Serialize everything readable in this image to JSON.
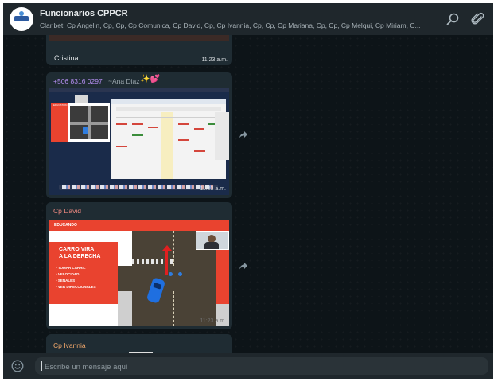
{
  "header": {
    "group_name": "Funcionarios CPPCR",
    "participants": "Claribet, Cp Angelin, Cp, Cp, Cp Comunica, Cp David, Cp, Cp Ivannia, Cp, Cp, Cp Mariana, Cp, Cp, Cp Melqui, Cp Miriam, C..."
  },
  "messages": [
    {
      "sender": "Cristina",
      "time": "11:23 a.m."
    },
    {
      "sender_phone": "+506 8316 0297",
      "sender_name": "~Ana Diaz",
      "emoji": "✨💕",
      "time": "11:23 a.m.",
      "screen": {
        "slide_tab": "EDUCATION",
        "weekday_headers": [
          "LU",
          "MA",
          "MI",
          "JU",
          "VI",
          "SA",
          "DO"
        ]
      }
    },
    {
      "sender": "Cp David",
      "time": "11:23 a.m.",
      "slide": {
        "tag": "EDUCANDO",
        "title_lines": [
          "CARRO VIRA",
          "A LA DERECHA"
        ],
        "bullets": [
          "• TOMAR CARRIL",
          "• VELOCIDAD",
          "• SEÑALES",
          "• VER DIRECCIONALES"
        ]
      }
    },
    {
      "sender": "Cp Ivannia"
    }
  ],
  "composer": {
    "placeholder": "Escribe un mensaje aquí"
  },
  "colors": {
    "cristina_name": "#dfe3e5",
    "ana_name": "#b48ef0",
    "david_name": "#f28b82",
    "ivannia_name": "#f2a86b",
    "slide_red": "#e9432f"
  },
  "icons": [
    "search-icon",
    "attach-icon",
    "forward-icon",
    "emoji-icon"
  ]
}
